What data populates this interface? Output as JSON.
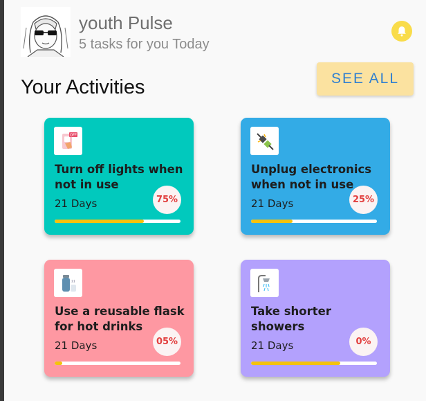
{
  "header": {
    "title": "youth Pulse",
    "subtitle": "5 tasks for you Today",
    "avatar_icon": "anime-avatar-icon",
    "bell_icon": "bell-icon"
  },
  "see_all_label": "SEE ALL",
  "section_title": "Your Activities",
  "activities": [
    {
      "title": "Turn off lights when not in use",
      "days": "21 Days",
      "percent_label": "75%",
      "progress": 0.71,
      "color": "#01c9bd",
      "icon": "light-switch-icon"
    },
    {
      "title": "Unplug electronics when not in use",
      "days": "21 Days",
      "percent_label": "25%",
      "progress": 0.33,
      "color": "#33abe6",
      "icon": "unplug-icon"
    },
    {
      "title": "Use a reusable flask for hot drinks",
      "days": "21 Days",
      "percent_label": "05%",
      "progress": 0.06,
      "color": "#fe98a2",
      "icon": "flask-icon"
    },
    {
      "title": "Take shorter showers",
      "days": "21 Days",
      "percent_label": "0%",
      "progress": 0.71,
      "color": "#b3a1fd",
      "icon": "shower-icon"
    }
  ],
  "colors": {
    "accent_text": "#2f7fd0",
    "see_all_bg": "#fbe2a0",
    "progress_fill": "#f4c20d",
    "badge_text": "#e2403f"
  }
}
